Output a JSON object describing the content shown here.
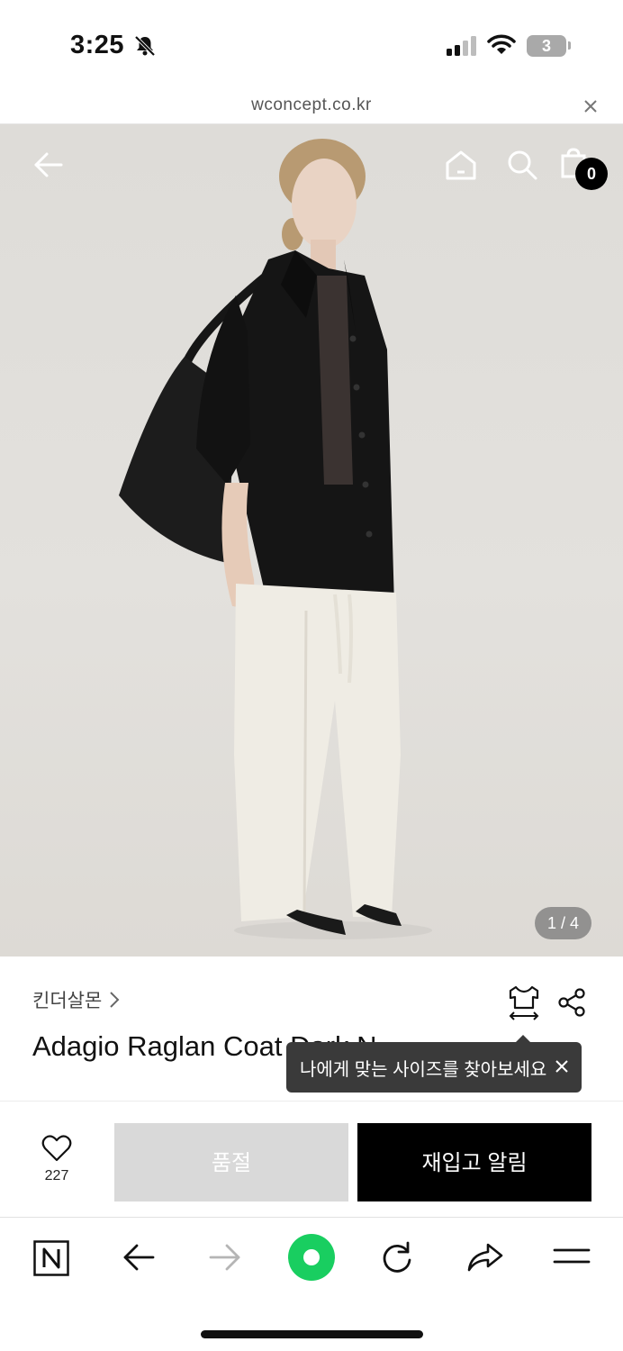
{
  "status_bar": {
    "time": "3:25",
    "battery": "3",
    "icons": [
      "bell-slash-icon",
      "cellular-signal-icon",
      "wifi-icon",
      "battery-icon"
    ]
  },
  "browser": {
    "url": "wconcept.co.kr",
    "close_icon": "close-icon"
  },
  "header_icons": {
    "back": "arrow-left-icon",
    "home": "home-icon",
    "search": "search-icon",
    "cart": "shopping-bag-icon",
    "cart_count": "0"
  },
  "gallery": {
    "indicator": "1 / 4"
  },
  "product": {
    "brand": "킨더살몬",
    "title": "Adagio Raglan Coat Dark N",
    "size_icon": "size-guide-icon",
    "share_icon": "share-icon"
  },
  "tooltip": {
    "text": "나에게 맞는 사이즈를 찾아보세요"
  },
  "purchase_bar": {
    "like_count": "227",
    "soldout_label": "품절",
    "restock_label": "재입고 알림"
  },
  "toolbar": {
    "items": [
      "naver-n-icon",
      "back-arrow-icon",
      "forward-arrow-icon",
      "green-dot-icon",
      "reload-icon",
      "share-arrow-icon",
      "menu-icon"
    ]
  },
  "colors": {
    "accent_green": "#19ce60",
    "primary_button": "#000000",
    "disabled_button": "#d9d9d9",
    "tooltip_bg": "#3a3a3a"
  }
}
